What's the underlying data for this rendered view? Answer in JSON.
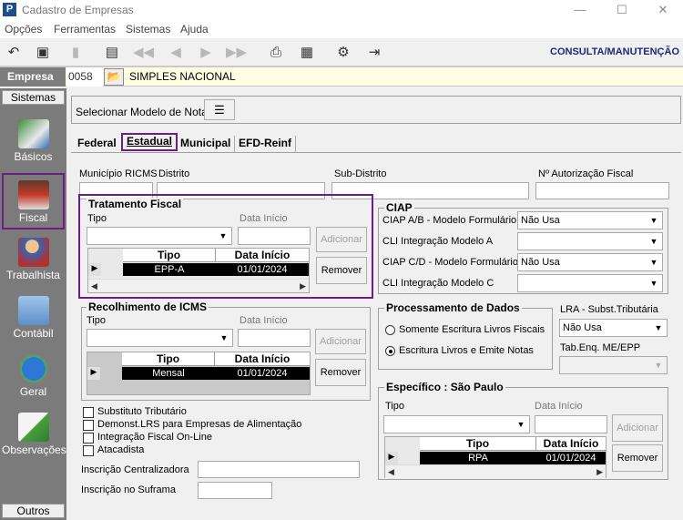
{
  "window": {
    "title": "Cadastro de Empresas",
    "minimize": "—",
    "maximize": "☐",
    "close": "✕"
  },
  "menu": [
    "Opções",
    "Ferramentas",
    "Sistemas",
    "Ajuda"
  ],
  "toolbar": {
    "mode_label": "CONSULTA/MANUTENÇÃO"
  },
  "empresa": {
    "label": "Empresa",
    "code": "0058",
    "name": "SIMPLES NACIONAL"
  },
  "sidebar": {
    "header_top": "Sistemas",
    "header_bottom": "Outros",
    "items": [
      {
        "label": "Básicos",
        "icon": "book-icon"
      },
      {
        "label": "Fiscal",
        "icon": "printer-icon"
      },
      {
        "label": "Trabalhista",
        "icon": "worker-icon"
      },
      {
        "label": "Contábil",
        "icon": "calculator-icon"
      },
      {
        "label": "Geral",
        "icon": "info-globe-icon"
      },
      {
        "label": "Observações",
        "icon": "notepad-icon"
      }
    ]
  },
  "modelo_nota": {
    "label": "Selecionar Modelo de Nota"
  },
  "tabs": [
    "Federal",
    "Estadual",
    "Municipal",
    "EFD-Reinf"
  ],
  "fields": {
    "municipio_ricms": "Município RICMS",
    "distrito": "Distrito",
    "sub_distrito": "Sub-Distrito",
    "autorizacao": "Nº Autorização Fiscal"
  },
  "tratamento": {
    "title": "Tratamento Fiscal",
    "tipo_label": "Tipo",
    "data_label": "Data Início",
    "add_button": "Adicionar",
    "remove_button": "Remover",
    "col_tipo": "Tipo",
    "col_data": "Data Início",
    "row_tipo": "EPP-A",
    "row_data": "01/01/2024"
  },
  "recolhimento": {
    "title": "Recolhimento de ICMS",
    "tipo_label": "Tipo",
    "data_label": "Data Início",
    "add_button": "Adicionar",
    "remove_button": "Remover",
    "col_tipo": "Tipo",
    "col_data": "Data Início",
    "row_tipo": "Mensal",
    "row_data": "01/01/2024"
  },
  "ciap": {
    "title": "CIAP",
    "ab_label": "CIAP  A/B - Modelo Formulário",
    "ab_value": "Não Usa",
    "cli_a_label": "CLI Integração Modelo A",
    "cd_label": "CIAP C/D - Modelo Formulário",
    "cd_value": "Não Usa",
    "cli_c_label": "CLI Integração Modelo C"
  },
  "processamento": {
    "title": "Processamento de Dados",
    "opt1": "Somente Escritura Livros Fiscais",
    "opt2": "Escritura Livros e Emite Notas",
    "selected": 2
  },
  "lra": {
    "label": "LRA - Subst.Tributária",
    "value": "Não Usa",
    "tab_label": "Tab.Enq. ME/EPP"
  },
  "especifico": {
    "title": "Específico : São Paulo",
    "tipo_label": "Tipo",
    "data_label": "Data Início",
    "add_button": "Adicionar",
    "remove_button": "Remover",
    "col_tipo": "Tipo",
    "col_data": "Data Início",
    "row_tipo": "RPA",
    "row_data": "01/01/2024"
  },
  "checkboxes": [
    "Substituto Tributário",
    "Demonst.LRS para Empresas de Alimentação",
    "Integração Fiscal On-Line",
    "Atacadista"
  ],
  "inscricao": {
    "centralizadora": "Inscrição Centralizadora",
    "suframa": "Inscrição no Suframa"
  }
}
